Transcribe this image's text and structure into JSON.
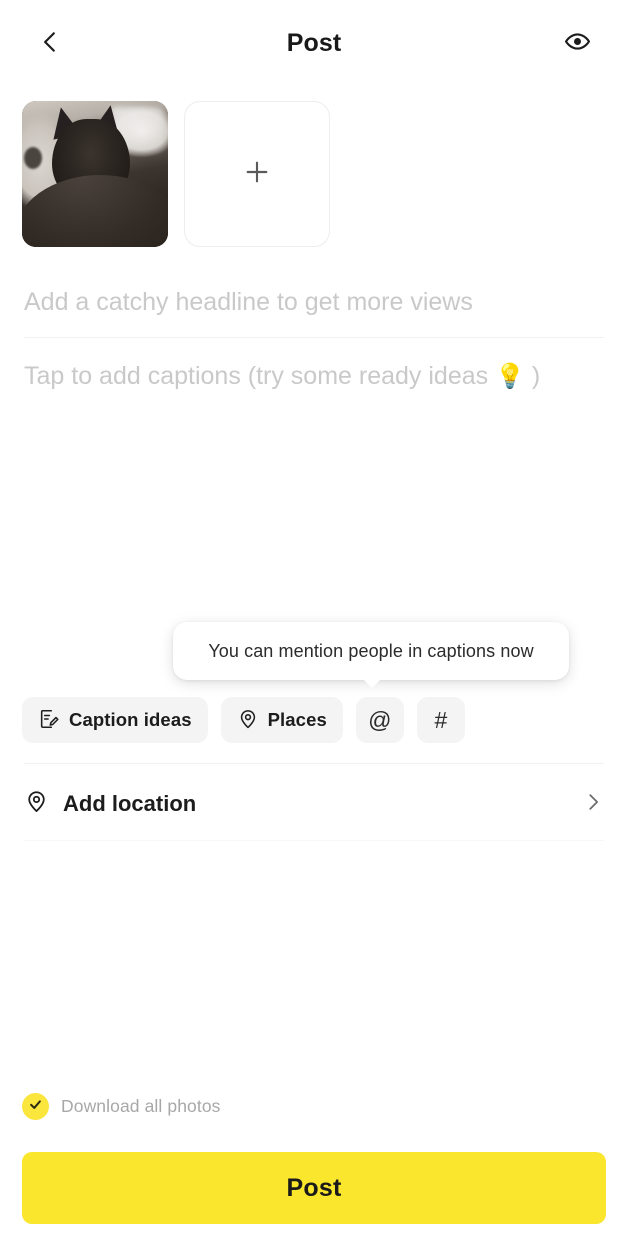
{
  "header": {
    "back_icon": "chevron-left-icon",
    "title": "Post",
    "preview_icon": "eye-icon"
  },
  "media": {
    "thumbnail_alt": "photo-of-dark-cat-lying-on-cushion",
    "add_icon": "plus-icon"
  },
  "fields": {
    "headline_placeholder": "Add a catchy headline to get more views",
    "headline_value": "",
    "caption_placeholder_before": "Tap to add captions (try some ready ideas ",
    "caption_bulb": "💡",
    "caption_placeholder_after": " )",
    "caption_value": ""
  },
  "tooltip": {
    "text": "You can mention people in captions now"
  },
  "chips": [
    {
      "label": "Caption ideas",
      "icon": "note-pencil-icon"
    },
    {
      "label": "Places",
      "icon": "map-pin-icon"
    },
    {
      "label": "@",
      "icon": "mention-icon"
    },
    {
      "label": "#",
      "icon": "hashtag-icon"
    }
  ],
  "location": {
    "icon": "map-pin-icon",
    "label": "Add location",
    "chevron": "chevron-right-icon"
  },
  "download": {
    "label": "Download all photos",
    "checked": true,
    "check_icon": "check-icon"
  },
  "submit": {
    "label": "Post"
  },
  "colors": {
    "accent_yellow": "#FAE62C",
    "checkbox_yellow": "#FAE63C",
    "text_primary": "#1a1a1a",
    "text_placeholder": "#c9c9c9",
    "chip_bg": "#f4f4f4",
    "divider": "#f1f1f1"
  }
}
